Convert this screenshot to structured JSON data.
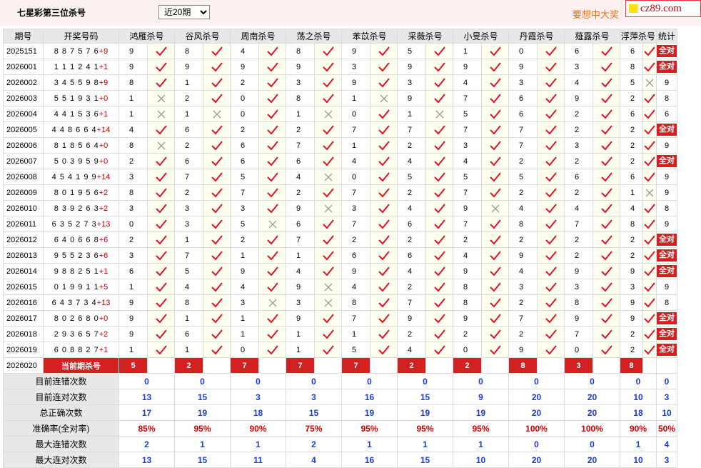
{
  "header": {
    "title": "七星彩第三位杀号",
    "period_select": {
      "selected": "近20期",
      "options": [
        "近20期"
      ]
    },
    "promo_text": "要想中大奖",
    "logo_text": "cz89.com"
  },
  "table": {
    "columns": [
      "期号",
      "开奖号码",
      "鸿雁杀号",
      "谷风杀号",
      "周南杀号",
      "荡之杀号",
      "苯苡杀号",
      "采薇杀号",
      "小旻杀号",
      "丹霞杀号",
      "薤露杀号",
      "浮萍杀号",
      "统计"
    ],
    "rows": [
      {
        "issue": "2025151",
        "digits": "887576",
        "plus": "+9",
        "kills": [
          "9",
          "8",
          "4",
          "8",
          "9",
          "5",
          "1",
          "0",
          "6",
          "6"
        ],
        "ok": [
          1,
          1,
          1,
          1,
          1,
          1,
          1,
          1,
          1,
          1
        ],
        "stat": "全对"
      },
      {
        "issue": "2026001",
        "digits": "111241",
        "plus": "+1",
        "kills": [
          "9",
          "9",
          "9",
          "9",
          "3",
          "9",
          "9",
          "9",
          "3",
          "8"
        ],
        "ok": [
          1,
          1,
          1,
          1,
          1,
          1,
          1,
          1,
          1,
          1
        ],
        "stat": "全对"
      },
      {
        "issue": "2026002",
        "digits": "345598",
        "plus": "+9",
        "kills": [
          "8",
          "1",
          "2",
          "3",
          "9",
          "3",
          "4",
          "3",
          "4",
          "5"
        ],
        "ok": [
          1,
          1,
          1,
          1,
          1,
          1,
          1,
          1,
          1,
          0
        ],
        "stat": "9"
      },
      {
        "issue": "2026003",
        "digits": "551931",
        "plus": "+0",
        "kills": [
          "1",
          "2",
          "0",
          "8",
          "1",
          "9",
          "7",
          "6",
          "9",
          "2"
        ],
        "ok": [
          0,
          1,
          1,
          1,
          0,
          1,
          1,
          1,
          1,
          1
        ],
        "stat": "8"
      },
      {
        "issue": "2026004",
        "digits": "441536",
        "plus": "+1",
        "kills": [
          "1",
          "1",
          "0",
          "1",
          "0",
          "1",
          "5",
          "6",
          "2",
          "6"
        ],
        "ok": [
          0,
          0,
          1,
          0,
          1,
          0,
          1,
          1,
          1,
          1
        ],
        "stat": "6"
      },
      {
        "issue": "2026005",
        "digits": "448664",
        "plus": "+14",
        "kills": [
          "4",
          "6",
          "2",
          "2",
          "7",
          "7",
          "7",
          "7",
          "2",
          "2"
        ],
        "ok": [
          1,
          1,
          1,
          1,
          1,
          1,
          1,
          1,
          1,
          1
        ],
        "stat": "全对"
      },
      {
        "issue": "2026006",
        "digits": "818564",
        "plus": "+0",
        "kills": [
          "8",
          "2",
          "6",
          "7",
          "1",
          "2",
          "3",
          "7",
          "3",
          "2"
        ],
        "ok": [
          0,
          1,
          1,
          1,
          1,
          1,
          1,
          1,
          1,
          1
        ],
        "stat": "9"
      },
      {
        "issue": "2026007",
        "digits": "503959",
        "plus": "+0",
        "kills": [
          "2",
          "6",
          "6",
          "6",
          "4",
          "4",
          "4",
          "2",
          "2",
          "2"
        ],
        "ok": [
          1,
          1,
          1,
          1,
          1,
          1,
          1,
          1,
          1,
          1
        ],
        "stat": "全对"
      },
      {
        "issue": "2026008",
        "digits": "454199",
        "plus": "+14",
        "kills": [
          "3",
          "7",
          "5",
          "4",
          "0",
          "5",
          "5",
          "5",
          "6",
          "6"
        ],
        "ok": [
          1,
          1,
          1,
          0,
          1,
          1,
          1,
          1,
          1,
          1
        ],
        "stat": "9"
      },
      {
        "issue": "2026009",
        "digits": "801956",
        "plus": "+2",
        "kills": [
          "8",
          "2",
          "7",
          "2",
          "7",
          "2",
          "7",
          "2",
          "2",
          "1"
        ],
        "ok": [
          1,
          1,
          1,
          1,
          1,
          1,
          1,
          1,
          1,
          0
        ],
        "stat": "9"
      },
      {
        "issue": "2026010",
        "digits": "839263",
        "plus": "+2",
        "kills": [
          "3",
          "3",
          "3",
          "9",
          "3",
          "4",
          "9",
          "4",
          "4",
          "4"
        ],
        "ok": [
          1,
          1,
          1,
          0,
          1,
          1,
          0,
          1,
          1,
          1
        ],
        "stat": "8"
      },
      {
        "issue": "2026011",
        "digits": "635273",
        "plus": "+13",
        "kills": [
          "0",
          "3",
          "5",
          "6",
          "7",
          "6",
          "7",
          "8",
          "7",
          "8"
        ],
        "ok": [
          1,
          1,
          0,
          1,
          1,
          1,
          1,
          1,
          1,
          1
        ],
        "stat": "9"
      },
      {
        "issue": "2026012",
        "digits": "640668",
        "plus": "+6",
        "kills": [
          "2",
          "1",
          "2",
          "7",
          "2",
          "2",
          "2",
          "2",
          "2",
          "2"
        ],
        "ok": [
          1,
          1,
          1,
          1,
          1,
          1,
          1,
          1,
          1,
          1
        ],
        "stat": "全对"
      },
      {
        "issue": "2026013",
        "digits": "955236",
        "plus": "+6",
        "kills": [
          "3",
          "7",
          "1",
          "1",
          "6",
          "6",
          "4",
          "9",
          "2",
          "2"
        ],
        "ok": [
          1,
          1,
          1,
          1,
          1,
          1,
          1,
          1,
          1,
          1
        ],
        "stat": "全对"
      },
      {
        "issue": "2026014",
        "digits": "988251",
        "plus": "+1",
        "kills": [
          "6",
          "5",
          "9",
          "4",
          "9",
          "4",
          "9",
          "4",
          "9",
          "9"
        ],
        "ok": [
          1,
          1,
          1,
          1,
          1,
          1,
          1,
          1,
          1,
          1
        ],
        "stat": "全对"
      },
      {
        "issue": "2026015",
        "digits": "019911",
        "plus": "+5",
        "kills": [
          "1",
          "4",
          "4",
          "9",
          "4",
          "2",
          "8",
          "3",
          "3",
          "3"
        ],
        "ok": [
          1,
          1,
          1,
          0,
          1,
          1,
          1,
          1,
          1,
          1
        ],
        "stat": "9"
      },
      {
        "issue": "2026016",
        "digits": "643734",
        "plus": "+13",
        "kills": [
          "9",
          "8",
          "3",
          "3",
          "8",
          "7",
          "8",
          "2",
          "8",
          "9"
        ],
        "ok": [
          1,
          1,
          0,
          0,
          1,
          1,
          1,
          1,
          1,
          1
        ],
        "stat": "8"
      },
      {
        "issue": "2026017",
        "digits": "802680",
        "plus": "+0",
        "kills": [
          "9",
          "1",
          "1",
          "9",
          "7",
          "9",
          "9",
          "7",
          "9",
          "9"
        ],
        "ok": [
          1,
          1,
          1,
          1,
          1,
          1,
          1,
          1,
          1,
          1
        ],
        "stat": "全对"
      },
      {
        "issue": "2026018",
        "digits": "293657",
        "plus": "+2",
        "kills": [
          "9",
          "6",
          "1",
          "1",
          "1",
          "2",
          "2",
          "2",
          "7",
          "2"
        ],
        "ok": [
          1,
          1,
          1,
          1,
          1,
          1,
          1,
          1,
          1,
          1
        ],
        "stat": "全对"
      },
      {
        "issue": "2026019",
        "digits": "608827",
        "plus": "+1",
        "kills": [
          "1",
          "1",
          "0",
          "1",
          "5",
          "4",
          "0",
          "9",
          "0",
          "2"
        ],
        "ok": [
          1,
          1,
          1,
          1,
          1,
          1,
          1,
          1,
          1,
          1
        ],
        "stat": "全对"
      }
    ],
    "current": {
      "issue": "2026020",
      "label": "当前期杀号",
      "kills": [
        "5",
        "2",
        "7",
        "7",
        "7",
        "2",
        "2",
        "8",
        "3",
        "8"
      ]
    },
    "summary": [
      {
        "label": "目前连错次数",
        "values": [
          "0",
          "0",
          "0",
          "0",
          "0",
          "0",
          "0",
          "0",
          "0",
          "0",
          "0"
        ],
        "red": false
      },
      {
        "label": "目前连对次数",
        "values": [
          "13",
          "15",
          "3",
          "3",
          "16",
          "15",
          "9",
          "20",
          "20",
          "10",
          "3"
        ],
        "red": false
      },
      {
        "label": "总正确次数",
        "values": [
          "17",
          "19",
          "18",
          "15",
          "19",
          "19",
          "19",
          "20",
          "20",
          "18",
          "10"
        ],
        "red": false
      },
      {
        "label": "准确率(全对率)",
        "values": [
          "85%",
          "95%",
          "90%",
          "75%",
          "95%",
          "95%",
          "95%",
          "100%",
          "100%",
          "90%",
          "50%"
        ],
        "red": true
      },
      {
        "label": "最大连错次数",
        "values": [
          "2",
          "1",
          "1",
          "2",
          "1",
          "1",
          "1",
          "0",
          "0",
          "1",
          "4"
        ],
        "red": false
      },
      {
        "label": "最大连对次数",
        "values": [
          "13",
          "15",
          "11",
          "4",
          "16",
          "15",
          "10",
          "20",
          "20",
          "10",
          "3"
        ],
        "red": false
      }
    ]
  },
  "colors": {
    "accent_red": "#d32020",
    "check_red": "#e0112b",
    "cross_gray": "#9a9a9a",
    "summary_blue": "#1a3fcf",
    "promo_orange": "#e8720c"
  }
}
